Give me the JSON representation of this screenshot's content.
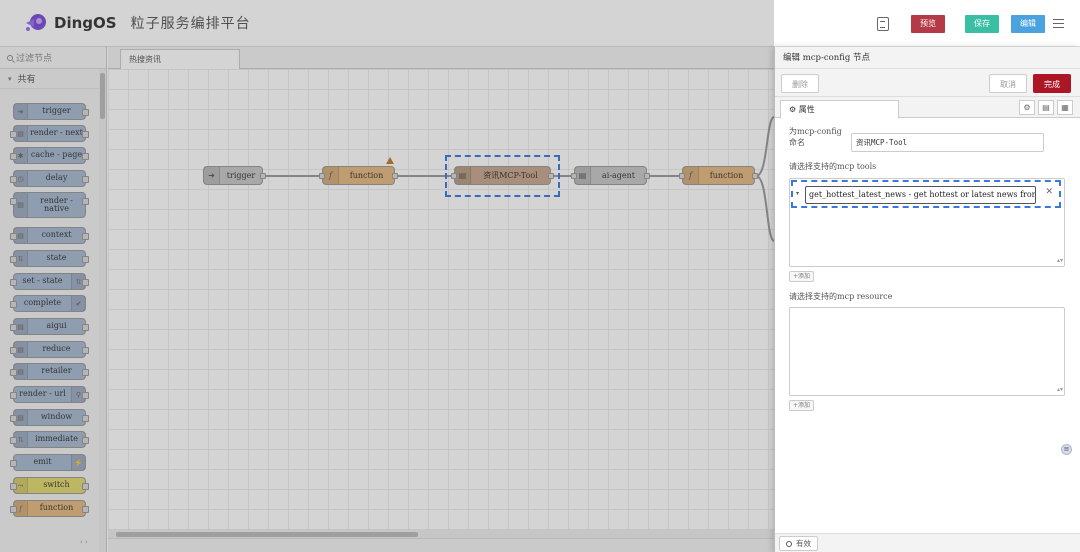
{
  "header": {
    "brand": "DingOS",
    "platform_title": "粒子服务编排平台",
    "buttons": {
      "preview": "预览",
      "save": "保存",
      "edit": "编辑"
    }
  },
  "palette": {
    "search_placeholder": "过滤节点",
    "category": "共有",
    "nodes": [
      {
        "label": "trigger",
        "color": "blue",
        "icon": "arrow-right-icon"
      },
      {
        "label": "render - next",
        "color": "blue",
        "icon": "file-icon"
      },
      {
        "label": "cache - page",
        "color": "blue",
        "icon": "gear-icon"
      },
      {
        "label": "delay",
        "color": "blue",
        "icon": "clock-icon"
      },
      {
        "label": "render - native",
        "color": "blue",
        "icon": "file-icon"
      },
      {
        "label": "context",
        "color": "blue",
        "icon": "file-icon"
      },
      {
        "label": "state",
        "color": "blue",
        "icon": "arrows-icon"
      },
      {
        "label": "set - state",
        "color": "blue",
        "icon": "arrows-icon"
      },
      {
        "label": "complete",
        "color": "blue",
        "icon": "check-icon"
      },
      {
        "label": "aigui",
        "color": "blue",
        "icon": "file-icon"
      },
      {
        "label": "reduce",
        "color": "blue",
        "icon": "file-icon"
      },
      {
        "label": "retailer",
        "color": "blue",
        "icon": "file-icon"
      },
      {
        "label": "render - url",
        "color": "blue",
        "icon": "link-icon"
      },
      {
        "label": "window",
        "color": "blue",
        "icon": "file-icon"
      },
      {
        "label": "immediate",
        "color": "blue",
        "icon": "arrows-icon"
      },
      {
        "label": "emit",
        "color": "blue",
        "icon": "bolt-icon"
      },
      {
        "label": "switch",
        "color": "yellow",
        "icon": "switch-icon"
      },
      {
        "label": "function",
        "color": "orange",
        "icon": "function-icon"
      }
    ]
  },
  "workspace": {
    "tab_label": "热搜资讯",
    "flow_nodes": [
      {
        "label": "trigger",
        "color": "grey",
        "icon": "arrow-right-icon"
      },
      {
        "label": "function",
        "color": "orange",
        "icon": "function-icon"
      },
      {
        "label": "资讯MCP-Tool",
        "color": "grey",
        "icon": "file-icon",
        "selected": true
      },
      {
        "label": "ai-agent",
        "color": "grey",
        "icon": "file-icon"
      },
      {
        "label": "function",
        "color": "orange",
        "icon": "function-icon"
      }
    ]
  },
  "editor": {
    "title": "编辑 mcp-config 节点",
    "delete_label": "删除",
    "cancel_label": "取消",
    "done_label": "完成",
    "properties_tab": "属性",
    "name_label_1": "为mcp-config",
    "name_label_2": "命名",
    "name_value": "资讯MCP-Tool",
    "tools_label": "请选择支持的mcp tools",
    "tool_selected": "get_hottest_latest_news - get hottest or latest news from",
    "add_label": "添加",
    "resource_label": "请选择支持的mcp resource",
    "enabled_label": "有效"
  },
  "colors": {
    "accent_blue": "#3a78e0",
    "done_red": "#ad1625",
    "preview_red": "#b33a46",
    "save_teal": "#3bbfa4",
    "edit_blue": "#4aa3df"
  }
}
